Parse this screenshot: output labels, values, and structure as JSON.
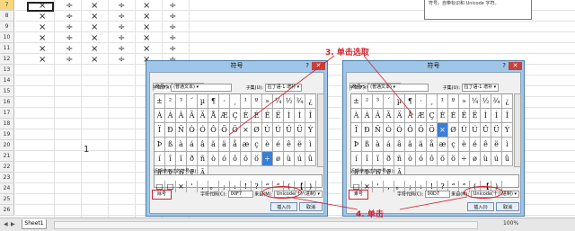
{
  "rows": [
    "7",
    "8",
    "9",
    "10",
    "11",
    "12",
    "13",
    "14",
    "15",
    "16",
    "17",
    "18",
    "19",
    "20",
    "21",
    "22",
    "23",
    "24",
    "25",
    "26"
  ],
  "symbols": {
    "times": "×",
    "divide": "÷"
  },
  "cell_value": "1",
  "tooltip_text": "符号。自带标识和 Unicode 字符。",
  "sheet_tab": "Sheet1",
  "zoom": "100%",
  "annotations": {
    "step3": "3. 单击选取",
    "step4": "4. 单击"
  },
  "dialog_left": {
    "title": "符号",
    "tab_symbols": "符号(S)",
    "tab_special": "特殊字符(P)",
    "font_label": "字体(F):",
    "font_value": "(普通文本)",
    "subset_label": "子集(U):",
    "subset_value": "拉丁语-1 增补",
    "recent_label": "近期使用过的符号(R):",
    "char_name": "除号",
    "char_code_label": "字符代码(C):",
    "char_code": "00F7",
    "from_label": "来自(M):",
    "from_value": "Unicode(十六进制)",
    "insert": "插入(I)",
    "cancel": "取消"
  },
  "dialog_right": {
    "title": "符号",
    "tab_symbols": "符号(S)",
    "tab_special": "特殊字符(P)",
    "font_label": "字体(F):",
    "font_value": "(普通文本)",
    "subset_label": "子集(U):",
    "subset_value": "拉丁语-1 增补",
    "recent_label": "近期使用过的符号(R):",
    "char_name": "乘号",
    "char_code_label": "字符代码(C):",
    "char_code": "00D7",
    "from_label": "来自(M):",
    "from_value": "Unicode(十六进制)",
    "insert": "插入(I)",
    "cancel": "取消"
  },
  "grid_left": [
    [
      "±",
      "²",
      "³",
      "´",
      "µ",
      "¶",
      "·",
      "¸",
      "¹",
      "º",
      "»",
      "¼",
      "½",
      "¾",
      "¿",
      "À"
    ],
    [
      "Á",
      "Â",
      "Ã",
      "Ä",
      "Å",
      "Æ",
      "Ç",
      "È",
      "É",
      "Ê",
      "Ë",
      "Ì",
      "Í",
      "Î",
      "Ï",
      "Ð"
    ],
    [
      "Ñ",
      "Ò",
      "Ó",
      "Ô",
      "Õ",
      "Ö",
      "×",
      "Ø",
      "Ù",
      "Ú",
      "Û",
      "Ü",
      "Ý",
      "Þ",
      "ß",
      "à"
    ],
    [
      "á",
      "â",
      "ã",
      "ä",
      "å",
      "æ",
      "ç",
      "è",
      "é",
      "ê",
      "ë",
      "ì",
      "í",
      "î",
      "ï",
      "ð"
    ],
    [
      "ñ",
      "ò",
      "ó",
      "ô",
      "õ",
      "ö",
      "÷",
      "ø",
      "ù",
      "ú",
      "û",
      "ü",
      "ý",
      "þ",
      "ÿ",
      "Ā"
    ]
  ],
  "grid_right": [
    [
      "±",
      "²",
      "³",
      "´",
      "µ",
      "¶",
      "·",
      "¸",
      "¹",
      "º",
      "»",
      "¼",
      "½",
      "¾",
      "¿",
      "À"
    ],
    [
      "Á",
      "Â",
      "Ã",
      "Ä",
      "Å",
      "Æ",
      "Ç",
      "È",
      "É",
      "Ê",
      "Ë",
      "Ì",
      "Í",
      "Î",
      "Ï",
      "Ð"
    ],
    [
      "Ñ",
      "Ò",
      "Ó",
      "Ô",
      "Õ",
      "Ö",
      "×",
      "Ø",
      "Ù",
      "Ú",
      "Û",
      "Ü",
      "Ý",
      "Þ",
      "ß",
      "à"
    ],
    [
      "á",
      "â",
      "ã",
      "ä",
      "å",
      "æ",
      "ç",
      "è",
      "é",
      "ê",
      "ë",
      "ì",
      "í",
      "î",
      "ï",
      "ð"
    ],
    [
      "ñ",
      "ò",
      "ó",
      "ô",
      "õ",
      "ö",
      "÷",
      "ø",
      "ù",
      "ú",
      "û",
      "ü",
      "ý",
      "þ",
      "ÿ",
      "Ā"
    ]
  ],
  "recent_left": [
    "□",
    "□",
    "×",
    "'",
    ",",
    "。",
    ";",
    ":",
    "!",
    "?",
    "“",
    "”",
    "(",
    "【",
    ")"
  ],
  "recent_right": [
    "□",
    "×",
    "'",
    ",",
    "。",
    ";",
    ":",
    "!",
    "?",
    "“",
    "”",
    "(",
    "【",
    ")"
  ],
  "highlight_left": "÷",
  "highlight_right": "×"
}
